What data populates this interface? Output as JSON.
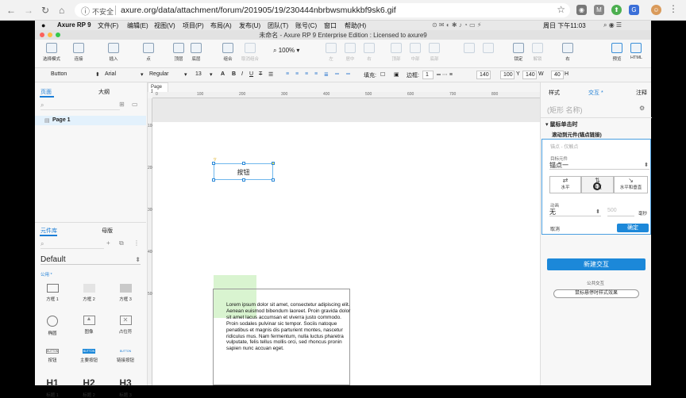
{
  "browser": {
    "insecure_label": "不安全",
    "url": "axure.org/data/attachment/forum/201905/19/230444nbrbwsmukkbf9sk6.gif"
  },
  "menubar": {
    "app_name": "Axure RP 9",
    "items": [
      "文件(F)",
      "编辑(E)",
      "视图(V)",
      "项目(P)",
      "布局(A)",
      "发布(U)",
      "团队(T)",
      "账号(C)",
      "窗口",
      "帮助(H)"
    ],
    "clock": "周日 下午11:03"
  },
  "window": {
    "title": "未命名 - Axure RP 9 Enterprise Edition : Licensed to axure9"
  },
  "toolbar": {
    "select_mode": "选择模式",
    "connect": "连接",
    "insert": "插入",
    "point": "点",
    "top": "顶层",
    "bottom": "底层",
    "group": "组合",
    "ungroup": "取消组合",
    "zoom": "100%",
    "left": "左",
    "center": "居中",
    "right": "右",
    "top2": "顶部",
    "middle": "中部",
    "bottom2": "底部",
    "distribute_h": "",
    "distribute_v": "",
    "lock": "锁定",
    "unlock": "解锁",
    "mode_right": "右",
    "preview": "预览",
    "html": "HTML"
  },
  "format": {
    "style": "Button",
    "font": "Arial",
    "weight": "Regular",
    "size": "13",
    "fill_label": "填充:",
    "border_label": "边框:",
    "border_value": "1",
    "x": "140",
    "y": "100",
    "w": "140",
    "h": "40",
    "y_label": "Y",
    "w_label": "W",
    "h_label": "H"
  },
  "left": {
    "tab_pages": "页面",
    "tab_outline": "大纲",
    "page1": "Page 1",
    "tab_library": "元件库",
    "tab_masters": "母版",
    "library_name": "Default",
    "section": "公用 *",
    "widgets": [
      {
        "label": "方框 1"
      },
      {
        "label": "方框 2"
      },
      {
        "label": "方框 3"
      },
      {
        "label": "椭圆"
      },
      {
        "label": "图像"
      },
      {
        "label": "占位符"
      },
      {
        "label": "按钮"
      },
      {
        "label": "主要按钮"
      },
      {
        "label": "链接按钮"
      },
      {
        "label": "标题 1"
      },
      {
        "label": "标题 2"
      },
      {
        "label": "标题 3"
      }
    ],
    "button_glyph": "BUTTON",
    "h1": "H1",
    "h2": "H2",
    "h3": "H3"
  },
  "canvas": {
    "page_tab": "Page 1",
    "ruler_top": [
      "0",
      "100",
      "200",
      "300",
      "400",
      "500",
      "600",
      "700",
      "800"
    ],
    "ruler_left": [
      "100",
      "200",
      "300",
      "400",
      "500"
    ],
    "button_text": "按钮",
    "lorem_html": "Lorem ipsum dolor sit amet, consectetur adipiscing elit. Aenean euismod bibendum laoreet. Proin gravida dolor sit amet lacus accumsan et viverra justo commodo. Proin sodales pulvinar sic tempor. Sociis natoque penatibus et magnis dis parturient montes, nascetur ridiculus mus. Nam fermentum, nulla luctus pharetra vulputate, felis tellus mollis orci, sed rhoncus pronin sapien nunc accuan eget."
  },
  "right": {
    "tab_style": "样式",
    "tab_interaction": "交互 *",
    "tab_notes": "注释",
    "shape_name_placeholder": "(矩形 名称)",
    "event": "鼠标单击时",
    "action": "滚动到元件(锚点链接)",
    "anchor_placeholder": "锚点 - 仅触点",
    "target_label": "目标元件",
    "target_value": "锚点一",
    "dir_h": "水平",
    "dir_v": "垂直",
    "dir_hv": "水平和垂直",
    "anim_label": "动画",
    "anim_value": "无",
    "duration": "500",
    "ms": "毫秒",
    "cancel": "取消",
    "ok": "确定",
    "new_interaction": "新建交互",
    "common_interaction": "公共交互",
    "hover_style": "鼠标悬停时样式效果"
  }
}
